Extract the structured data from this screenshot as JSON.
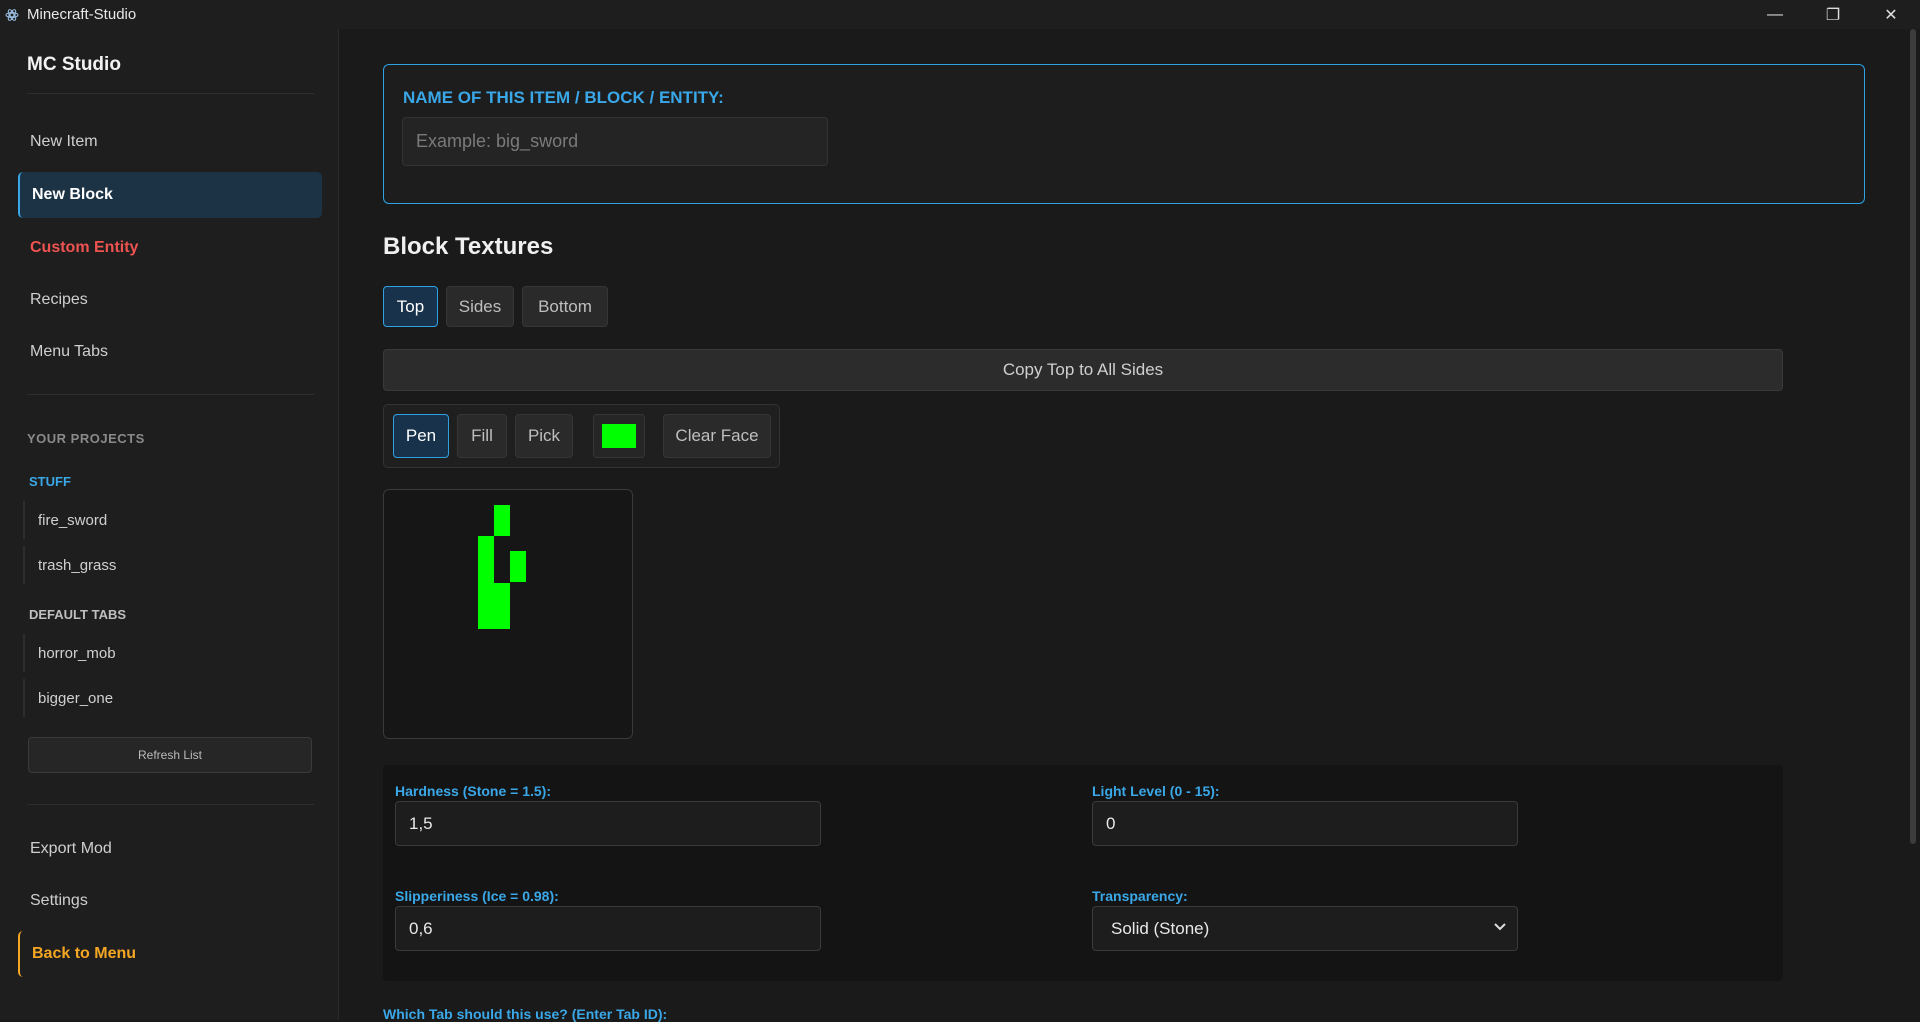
{
  "window": {
    "title": "Minecraft-Studio",
    "minimize": "—",
    "maximize": "❐",
    "close": "✕"
  },
  "sidebar": {
    "brand": "MC Studio",
    "nav": [
      {
        "label": "New Item"
      },
      {
        "label": "New Block"
      },
      {
        "label": "Custom Entity"
      },
      {
        "label": "Recipes"
      },
      {
        "label": "Menu Tabs"
      }
    ],
    "projects_heading": "YOUR PROJECTS",
    "groups": [
      {
        "label": "STUFF",
        "color": "#3aa8e8",
        "items": [
          "fire_sword",
          "trash_grass"
        ]
      },
      {
        "label": "DEFAULT TABS",
        "color": "#bfbfbf",
        "items": [
          "horror_mob",
          "bigger_one"
        ]
      }
    ],
    "refresh": "Refresh List",
    "footer": [
      {
        "label": "Export Mod"
      },
      {
        "label": "Settings"
      },
      {
        "label": "Back to Menu"
      }
    ]
  },
  "main": {
    "name_label": "NAME OF THIS ITEM / BLOCK / ENTITY:",
    "name_placeholder": "Example: big_sword",
    "name_value": "",
    "textures_heading": "Block Textures",
    "face_tabs": [
      "Top",
      "Sides",
      "Bottom"
    ],
    "active_face": "Top",
    "copy_button": "Copy Top to All Sides",
    "tools": [
      "Pen",
      "Fill",
      "Pick"
    ],
    "active_tool": "Pen",
    "paint_color": "#00ff00",
    "clear_button": "Clear Face",
    "properties": {
      "hardness_label": "Hardness (Stone = 1.5):",
      "hardness_value": "1,5",
      "light_label": "Light Level (0 - 15):",
      "light_value": "0",
      "slipperiness_label": "Slipperiness (Ice = 0.98):",
      "slipperiness_value": "0,6",
      "transparency_label": "Transparency:",
      "transparency_value": "Solid (Stone)"
    },
    "tab_question": "Which Tab should this use? (Enter Tab ID):"
  }
}
